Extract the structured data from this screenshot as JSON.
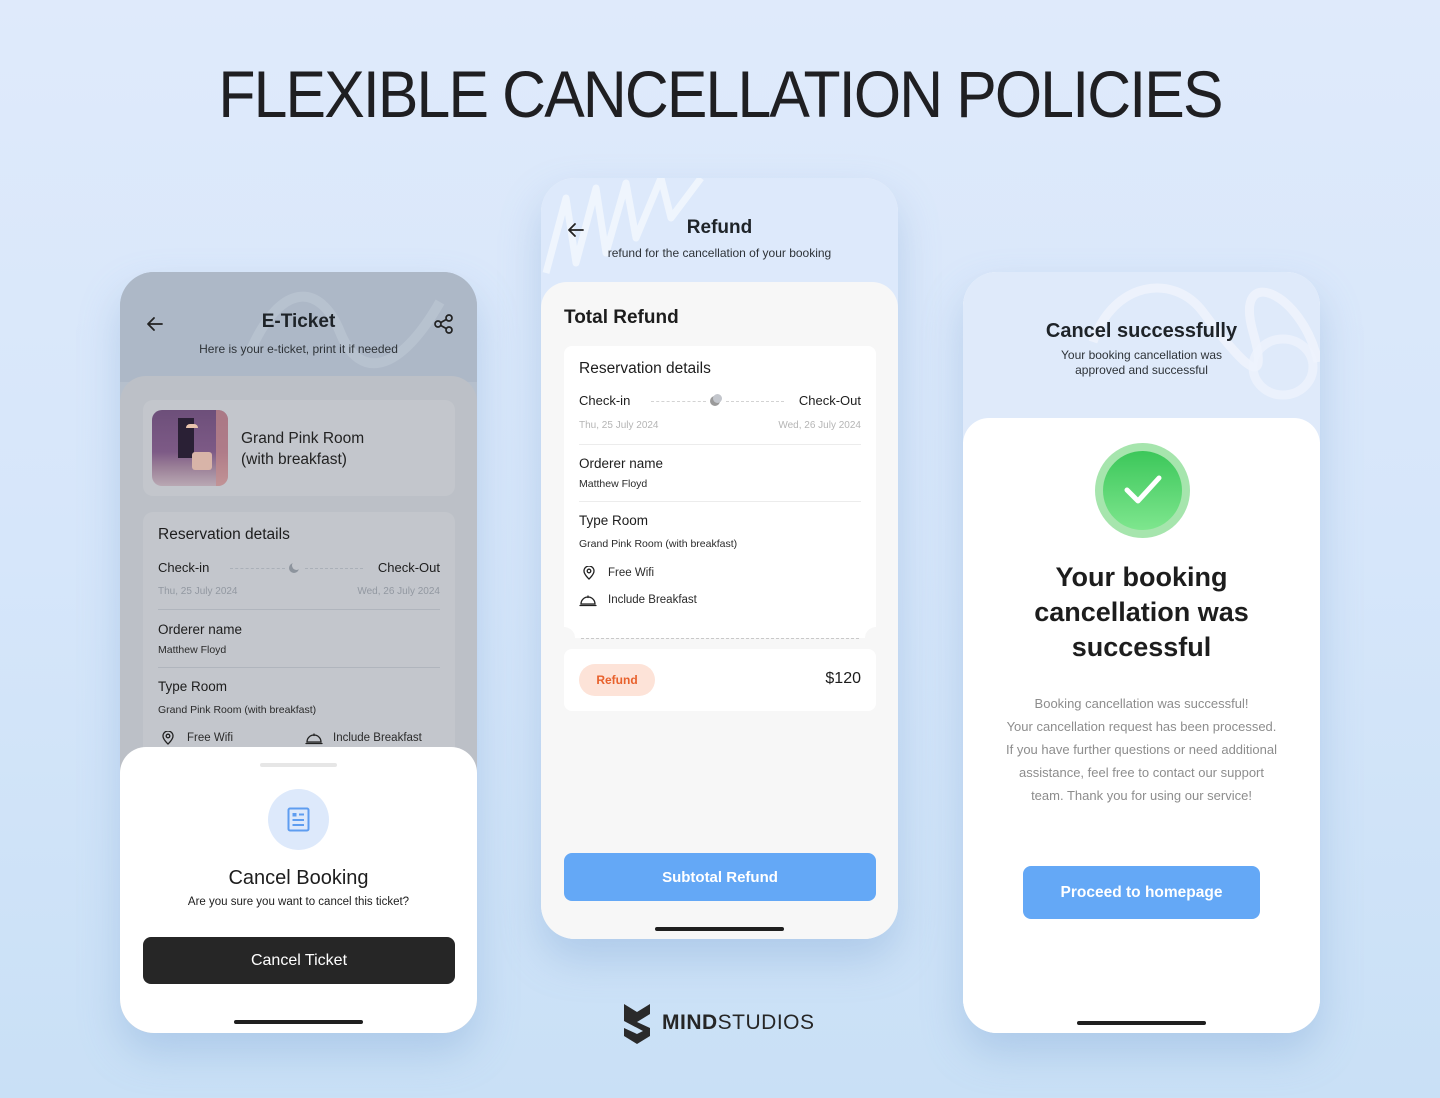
{
  "headline": "FLEXIBLE CANCELLATION POLICIES",
  "brand": {
    "bold": "MIND",
    "regular": "STUDIOS",
    "logo_icon": "mindstudios-logo-icon"
  },
  "colors": {
    "accent_blue": "#64a8f6",
    "dark_button": "#262626",
    "refund_badge_bg": "#fde3d8",
    "refund_badge_text": "#e8612c",
    "success_green": "#3cc75a"
  },
  "eticket": {
    "title": "E-Ticket",
    "subtitle": "Here is your e-ticket, print it if needed",
    "back_icon": "arrow-left-icon",
    "share_icon": "share-icon",
    "hotel": {
      "name_line1": "Grand Pink Room",
      "name_line2": "(with breakfast)"
    },
    "reservation": {
      "title": "Reservation details",
      "checkin_label": "Check-in",
      "checkout_label": "Check-Out",
      "checkin_date": "Thu, 25 July 2024",
      "checkout_date": "Wed, 26 July 2024",
      "orderer_label": "Orderer name",
      "orderer_value": "Matthew Floyd",
      "type_label": "Type Room",
      "type_value": "Grand Pink Room (with breakfast)",
      "amenities": [
        "Free Wifi",
        "Include Breakfast"
      ]
    },
    "sheet": {
      "title": "Cancel Booking",
      "subtitle": "Are you sure you want to cancel this ticket?",
      "button": "Cancel Ticket"
    }
  },
  "refund": {
    "title": "Refund",
    "subtitle": "refund for the cancellation of your booking",
    "section_title": "Total Refund",
    "reservation": {
      "title": "Reservation details",
      "checkin_label": "Check-in",
      "checkout_label": "Check-Out",
      "checkin_date": "Thu, 25 July 2024",
      "checkout_date": "Wed, 26 July 2024",
      "orderer_label": "Orderer name",
      "orderer_value": "Matthew Floyd",
      "type_label": "Type Room",
      "type_value": "Grand Pink Room (with breakfast)",
      "amenities": [
        "Free Wifi",
        "Include Breakfast"
      ]
    },
    "badge": "Refund",
    "amount": "$120",
    "button": "Subtotal Refund"
  },
  "success": {
    "title": "Cancel successfully",
    "subtitle_line1": "Your booking cancellation was",
    "subtitle_line2": "approved and successful",
    "big_title_lines": [
      "Your booking",
      "cancellation was",
      "successful"
    ],
    "paragraph_lines": [
      "Booking cancellation was successful!",
      "Your cancellation request has been processed.",
      "If you have further questions or need additional",
      "assistance, feel free to contact our support",
      "team. Thank you for using our service!"
    ],
    "button": "Proceed to homepage"
  }
}
